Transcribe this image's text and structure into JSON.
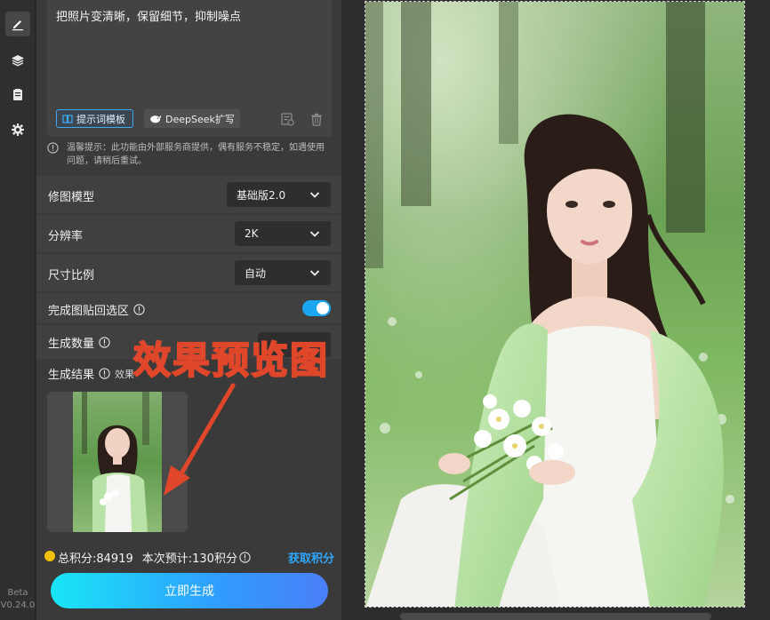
{
  "rail": {
    "version_line1": "Beta",
    "version_line2": "V0.24.0"
  },
  "prompt": {
    "text": "把照片变清晰，保留细节，抑制噪点",
    "template_label": "提示词模板",
    "deepseek_label": "DeepSeek扩写"
  },
  "notice": {
    "text": "温馨提示：此功能由外部服务商提供，偶有服务不稳定，如遇使用问题，请稍后重试。"
  },
  "settings": {
    "model_label": "修图模型",
    "model_value": "基础版2.0",
    "resolution_label": "分辨率",
    "resolution_value": "2K",
    "ratio_label": "尺寸比例",
    "ratio_value": "自动",
    "paste_back_label": "完成图贴回选区",
    "count_label": "生成数量",
    "result_label": "生成结果",
    "result_hint": "效果"
  },
  "points": {
    "total": "总积分:84919",
    "estimate": "本次预计:130积分",
    "get_label": "获取积分"
  },
  "generate_label": "立即生成",
  "annotation": {
    "text": "效果预览图"
  },
  "colors": {
    "accent": "#2ea8ff",
    "annotation": "#e0462a",
    "coin": "#f4c20d"
  }
}
